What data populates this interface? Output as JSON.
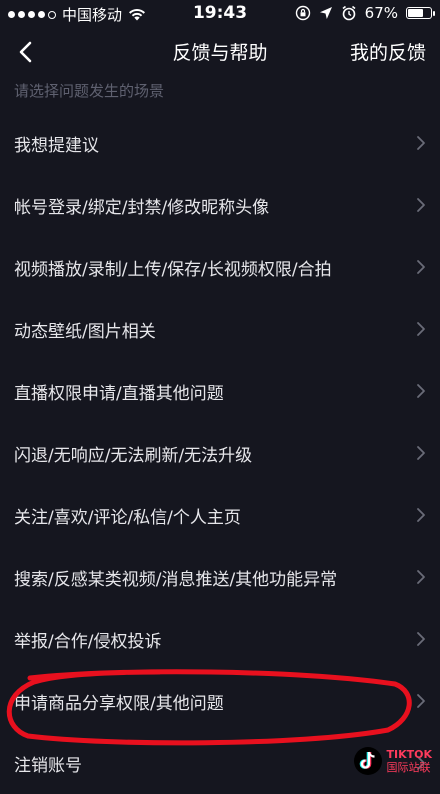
{
  "status_bar": {
    "carrier": "中国移动",
    "time": "19:43",
    "battery_percent": 67,
    "battery_text": "67%"
  },
  "nav": {
    "title": "反馈与帮助",
    "right_action": "我的反馈"
  },
  "section_hint": "请选择问题发生的场景",
  "items": [
    {
      "label": "我想提建议"
    },
    {
      "label": "帐号登录/绑定/封禁/修改昵称头像"
    },
    {
      "label": "视频播放/录制/上传/保存/长视频权限/合拍"
    },
    {
      "label": "动态壁纸/图片相关"
    },
    {
      "label": "直播权限申请/直播其他问题"
    },
    {
      "label": "闪退/无响应/无法刷新/无法升级"
    },
    {
      "label": "关注/喜欢/评论/私信/个人主页"
    },
    {
      "label": "搜索/反感某类视频/消息推送/其他功能异常"
    },
    {
      "label": "举报/合作/侵权投诉"
    },
    {
      "label": "申请商品分享权限/其他问题"
    },
    {
      "label": "注销账号"
    }
  ],
  "watermark": {
    "line1": "TIKTOK",
    "line2": "国际站联"
  },
  "colors": {
    "background": "#15161f",
    "text": "#e6e6ea",
    "hint": "#5f6170",
    "chevron": "#6a6c78",
    "annotation": "#e8101e"
  }
}
